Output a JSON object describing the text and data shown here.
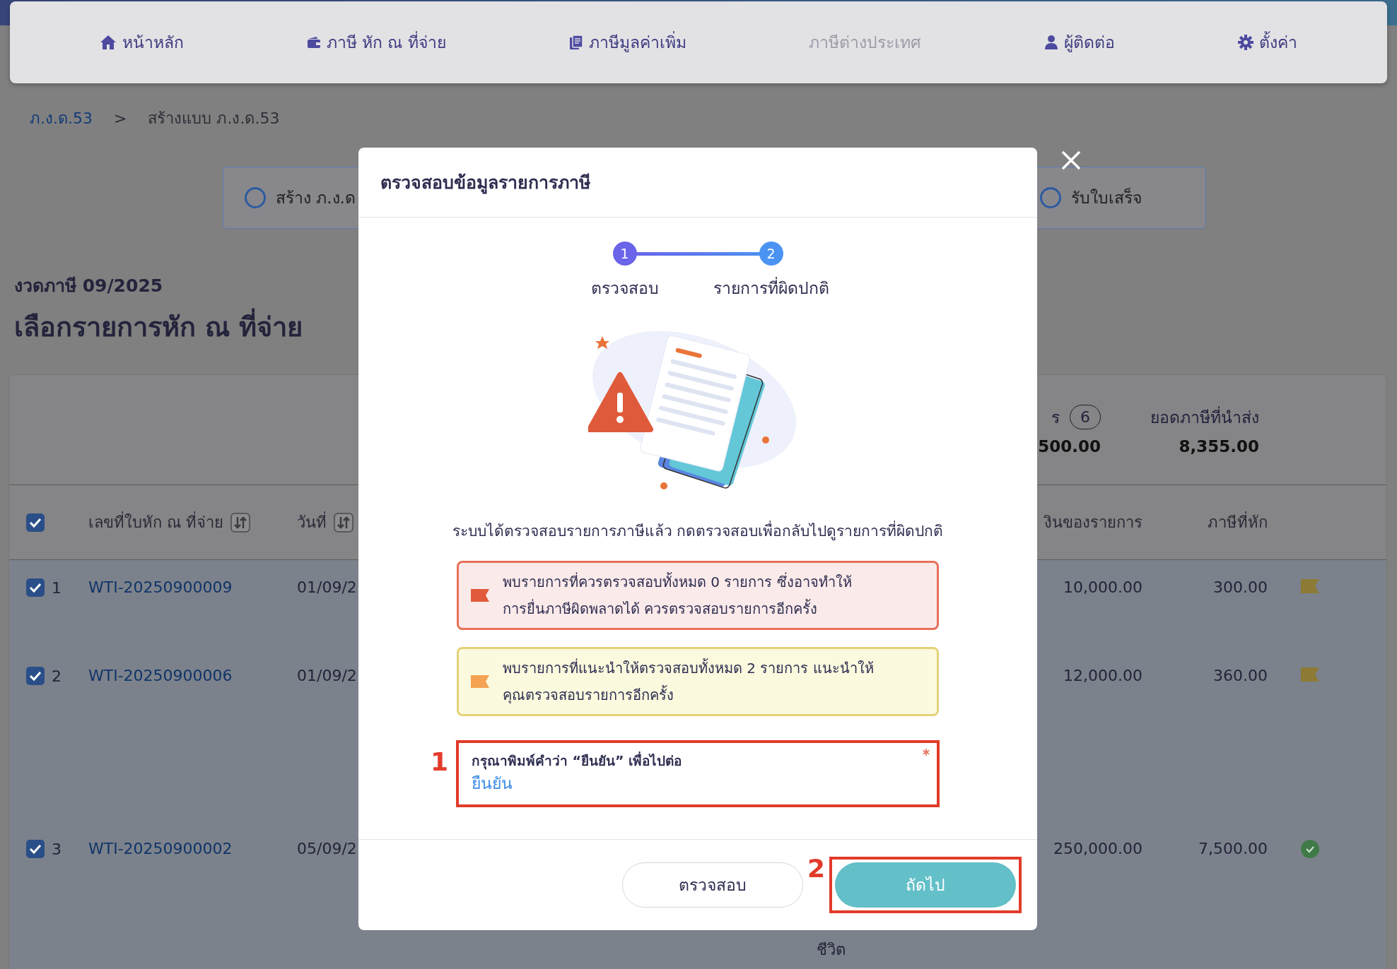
{
  "nav": [
    {
      "label": "หน้าหลัก",
      "disabled": false
    },
    {
      "label": "ภาษี หัก ณ ที่จ่าย",
      "disabled": false
    },
    {
      "label": "ภาษีมูลค่าเพิ่ม",
      "disabled": false
    },
    {
      "label": "ภาษีต่างประเทศ",
      "disabled": true
    },
    {
      "label": "ผู้ติดต่อ",
      "disabled": false
    },
    {
      "label": "ตั้งค่า",
      "disabled": false
    }
  ],
  "breadcrumb": [
    {
      "label": "ภ.ง.ด.53",
      "kind": "link"
    },
    {
      "label": ">",
      "kind": "separator"
    },
    {
      "label": "สร้างแบบ ภ.ง.ด.53",
      "kind": "current"
    }
  ],
  "progress_steps": [
    {
      "label": "สร้าง ภ.ง.ด"
    },
    {
      "label": "รับใบเสร็จ"
    }
  ],
  "period": "งวดภาษี 09/2025",
  "heading": "เลือกรายการหัก ณ ที่จ่าย",
  "summary": [
    {
      "label": "ร",
      "badge": "6",
      "value": "500.00"
    },
    {
      "label": "ยอดภาษีที่นำส่ง",
      "value": "8,355.00"
    }
  ],
  "table": {
    "all_checked": true,
    "columns": [
      {
        "label": "เลขที่ใบหัก ณ ที่จ่าย",
        "sortable": true
      },
      {
        "label": "วันที่",
        "sortable": true
      },
      {
        "label": "งินของรายการ",
        "sortable": false
      },
      {
        "label": "ภาษีที่หัก",
        "sortable": false
      }
    ],
    "rows": [
      {
        "checked": true,
        "number": "1",
        "doc_no": "WTI-20250900009",
        "date": "01/09/2",
        "amount": "10,000.00",
        "tax": "300.00",
        "flagged": true
      },
      {
        "checked": true,
        "number": "2",
        "doc_no": "WTI-20250900006",
        "date": "01/09/2",
        "amount": "12,000.00",
        "tax": "360.00",
        "flagged": true
      },
      {
        "checked": true,
        "number": "3",
        "doc_no": "WTI-20250900002",
        "date": "05/09/2",
        "note": "ชีวิต",
        "amount": "250,000.00",
        "tax": "7,500.00",
        "flagged": false
      }
    ]
  },
  "modal": {
    "title": "ตรวจสอบข้อมูลรายการภาษี",
    "stepper": [
      {
        "number": "1",
        "label": "ตรวจสอบ",
        "color": "#6b63e8"
      },
      {
        "number": "2",
        "label": "รายการที่ผิดปกติ",
        "color": "#4b93f2"
      }
    ],
    "message": "ระบบได้ตรวจสอบรายการภาษีแล้ว กดตรวจสอบเพื่อกลับไปดูรายการที่ผิดปกติ",
    "alerts": [
      {
        "kind": "error",
        "text": "พบรายการที่ควรตรวจสอบทั้งหมด 0 รายการ ซึ่งอาจทำให้\nการยื่นภาษีผิดพลาดได้ ควรตรวจสอบรายการอีกครั้ง"
      },
      {
        "kind": "warning",
        "text": "พบรายการที่แนะนำให้ตรวจสอบทั้งหมด 2 รายการ แนะนำให้\nคุณตรวจสอบรายการอีกครั้ง"
      }
    ],
    "confirm_field": {
      "label": "กรุณาพิมพ์คำว่า “ยืนยัน” เพื่อไปต่อ",
      "required": true,
      "value": "ยืนยัน"
    },
    "buttons": [
      {
        "label": "ตรวจสอบ",
        "kind": "secondary"
      },
      {
        "label": "ถัดไป",
        "kind": "primary"
      }
    ]
  },
  "annotations": [
    {
      "label": "1"
    },
    {
      "label": "2"
    }
  ]
}
